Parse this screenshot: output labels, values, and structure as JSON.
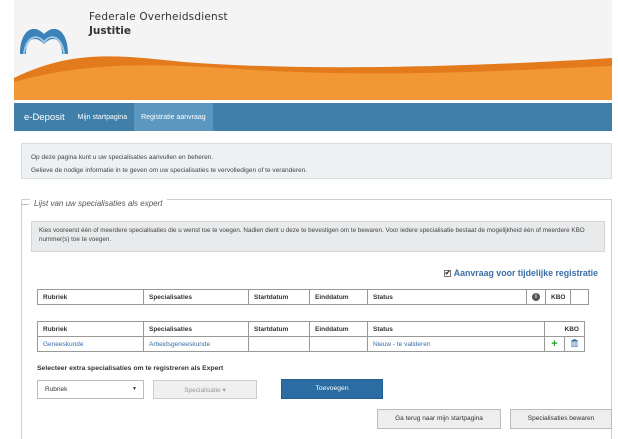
{
  "header": {
    "org_line1": "Federale Overheidsdienst",
    "org_line2": "Justitie"
  },
  "navbar": {
    "brand": "e-Deposit",
    "items": [
      {
        "label": "Mijn startpagina",
        "active": false
      },
      {
        "label": "Registratie aanvraag",
        "active": true
      }
    ]
  },
  "intro": {
    "line1": "Op deze pagina kunt u uw specialisaties aanvullen en beheren.",
    "line2": "Gelieve de nodige informatie in te geven om uw specialisaties te vervolledigen of te veranderen."
  },
  "section": {
    "legend": "Lijst van uw specialisaties als expert",
    "guide": "Kies vooreerst één of meerdere specialisaties die u wenst toe te voegen. Nadien dient u deze te bevestigen om te bewaren. Voor iedere specialisatie bestaat de mogelijkheid één of meerdere KBO nummer(s) toe te voegen.",
    "temp_checkbox_label": "Aanvraag voor tijdelijke registratie",
    "temp_checked": true
  },
  "table_headers": {
    "rubriek": "Rubriek",
    "specialisaties": "Specialisaties",
    "startdatum": "Startdatum",
    "einddatum": "Einddatum",
    "status": "Status",
    "kbo": "KBO"
  },
  "rows": [
    {
      "rubriek": "Geneeskunde",
      "specialisatie": "Arbeidsgeneeskunde",
      "startdatum": "",
      "einddatum": "",
      "status": "Nieuw - te valideren"
    }
  ],
  "add": {
    "label": "Selecteer extra specialisaties om te registreren als Expert",
    "rubriek_value": "Rubriek",
    "specialisatie_value": "Specialisatie",
    "add_button": "Toevoegen"
  },
  "actions": {
    "back": "Ga terug naar mijn startpagina",
    "save": "Specialisaties bewaren"
  },
  "colors": {
    "navbar": "#3f7fa8",
    "accent_orange": "#f08a24",
    "link": "#3a6ea5",
    "primary_button": "#2b6ca3"
  }
}
